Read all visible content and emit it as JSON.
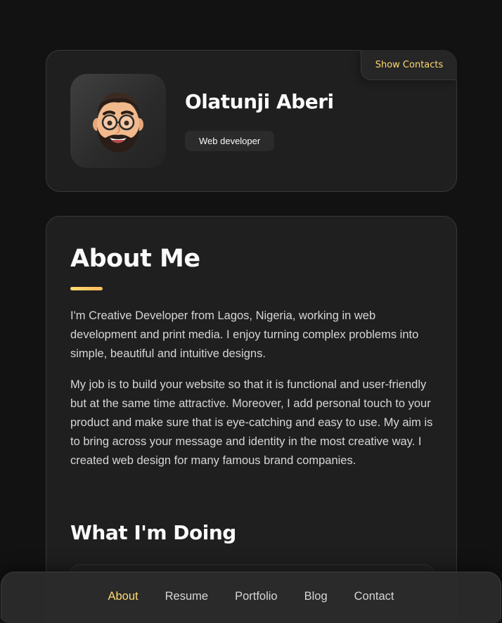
{
  "profile": {
    "show_contacts_label": "Show Contacts",
    "name": "Olatunji Aberi",
    "role": "Web developer"
  },
  "about": {
    "title": "About Me",
    "paragraph_1": "I'm Creative Developer from Lagos, Nigeria, working in web development and print media. I enjoy turning complex problems into simple, beautiful and intuitive designs.",
    "paragraph_2": "My job is to build your website so that it is functional and user-friendly but at the same time attractive. Moreover, I add personal touch to your product and make sure that is eye-catching and easy to use. My aim is to bring across your message and identity in the most creative way. I created web design for many famous brand companies.",
    "doing_title": "What I'm Doing"
  },
  "navbar": {
    "items": [
      {
        "label": "About",
        "active": true
      },
      {
        "label": "Resume",
        "active": false
      },
      {
        "label": "Portfolio",
        "active": false
      },
      {
        "label": "Blog",
        "active": false
      },
      {
        "label": "Contact",
        "active": false
      }
    ]
  },
  "colors": {
    "accent": "#ffdb70",
    "background": "#121212",
    "card": "#1f1f1f",
    "text": "#fafafa"
  },
  "icons": {
    "avatar": "memoji-avatar-icon"
  }
}
